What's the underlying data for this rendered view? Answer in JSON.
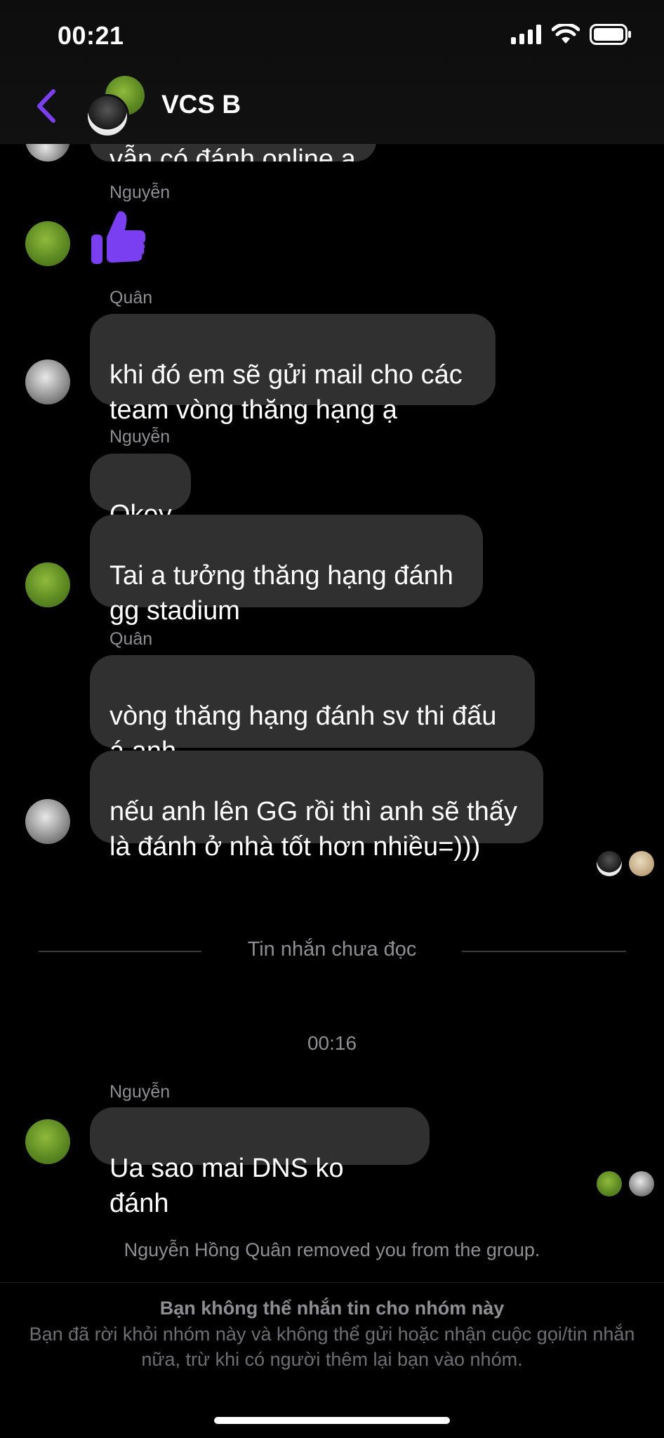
{
  "status_bar": {
    "time": "00:21"
  },
  "header": {
    "title": "VCS B"
  },
  "messages": {
    "m0_partial": "vẫn có đánh online ạ",
    "g1_sender": "Nguyễn",
    "g2_sender": "Quân",
    "g2_text": "khi đó em sẽ gửi mail cho các\nteam vòng thăng hạng ạ",
    "g3_sender": "Nguyễn",
    "g3_text1": "Okey",
    "g3_text2": "Tai a tưởng thăng hạng đánh\ngg stadium",
    "g4_sender": "Quân",
    "g4_text1": "vòng thăng hạng đánh sv thi đấu\ná anh",
    "g4_text2": "nếu anh lên GG rồi thì anh sẽ thấy\nlà đánh ở nhà tốt hơn nhiều=)))",
    "g5_sender": "Nguyễn",
    "g5_text": "Ua sao mai DNS ko đánh"
  },
  "divider": {
    "label": "Tin nhắn chưa đọc"
  },
  "timestamp": "00:16",
  "system": {
    "removed": "Nguyễn Hồng Quân removed you from the group.",
    "notice_title": "Bạn không thể nhắn tin cho nhóm này",
    "notice_body": "Bạn đã rời khỏi nhóm này và không thể gửi hoặc nhận cuộc gọi/tin nhắn nữa, trừ khi có người thêm lại bạn vào nhóm."
  },
  "colors": {
    "accent": "#7b3ff2",
    "bubble": "#303030",
    "secondary_text": "#8e8e93"
  },
  "icons": {
    "back": "chevron-left-icon",
    "like": "thumbs-up-icon"
  }
}
